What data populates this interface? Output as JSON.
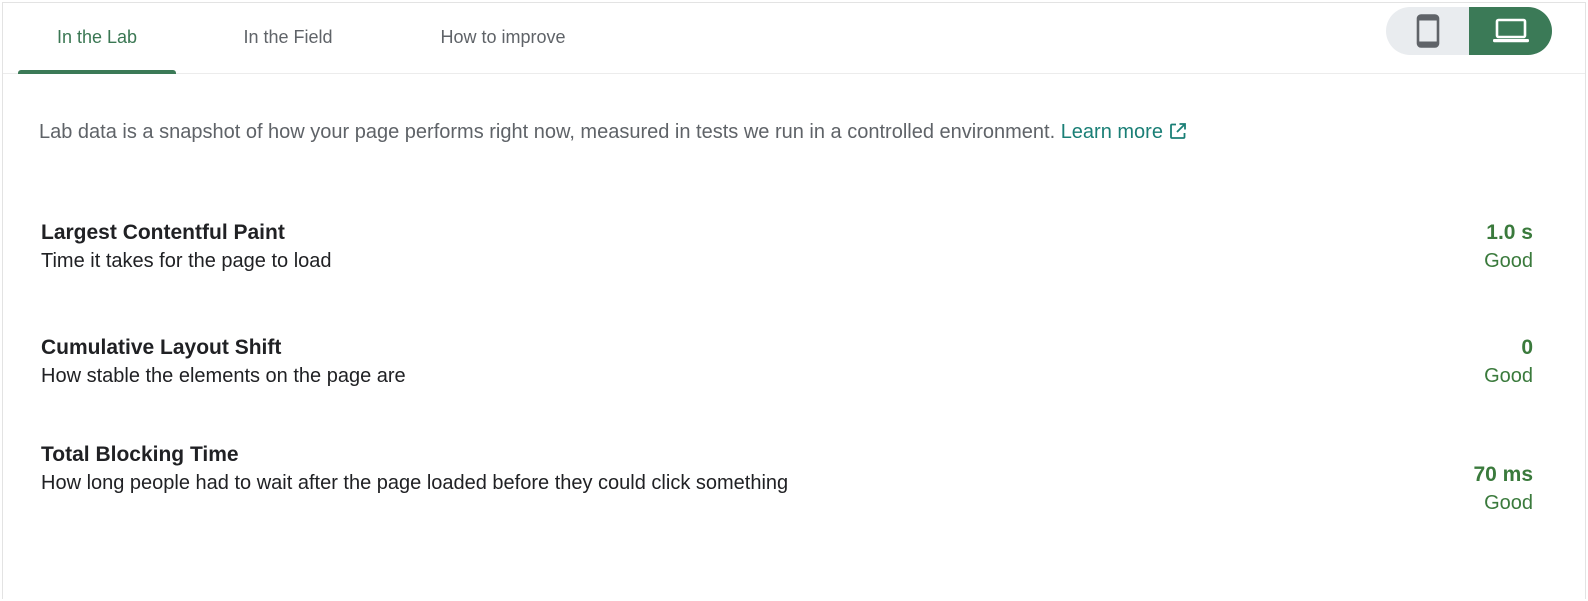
{
  "tabs": [
    {
      "label": "In the Lab",
      "active": true
    },
    {
      "label": "In the Field",
      "active": false
    },
    {
      "label": "How to improve",
      "active": false
    }
  ],
  "device_toggle": {
    "options": [
      {
        "icon": "mobile-phone-icon",
        "selected": false
      },
      {
        "icon": "laptop-icon",
        "selected": true
      }
    ]
  },
  "intro": {
    "text": "Lab data is a snapshot of how your page performs right now, measured in tests we run in a controlled environment.",
    "link_label": "Learn more",
    "link_icon": "external-link-icon"
  },
  "metrics": [
    {
      "name": "Largest Contentful Paint",
      "description": "Time it takes for the page to load",
      "value": "1.0 s",
      "rating": "Good"
    },
    {
      "name": "Cumulative Layout Shift",
      "description": "How stable the elements on the page are",
      "value": "0",
      "rating": "Good"
    },
    {
      "name": "Total Blocking Time",
      "description": "How long people had to wait after the page loaded before they could click something",
      "value": "70 ms",
      "rating": "Good"
    }
  ],
  "colors": {
    "accent": "#3b7a57",
    "good": "#3a7a3c",
    "link": "#1a7f76",
    "muted": "#5f6368"
  }
}
